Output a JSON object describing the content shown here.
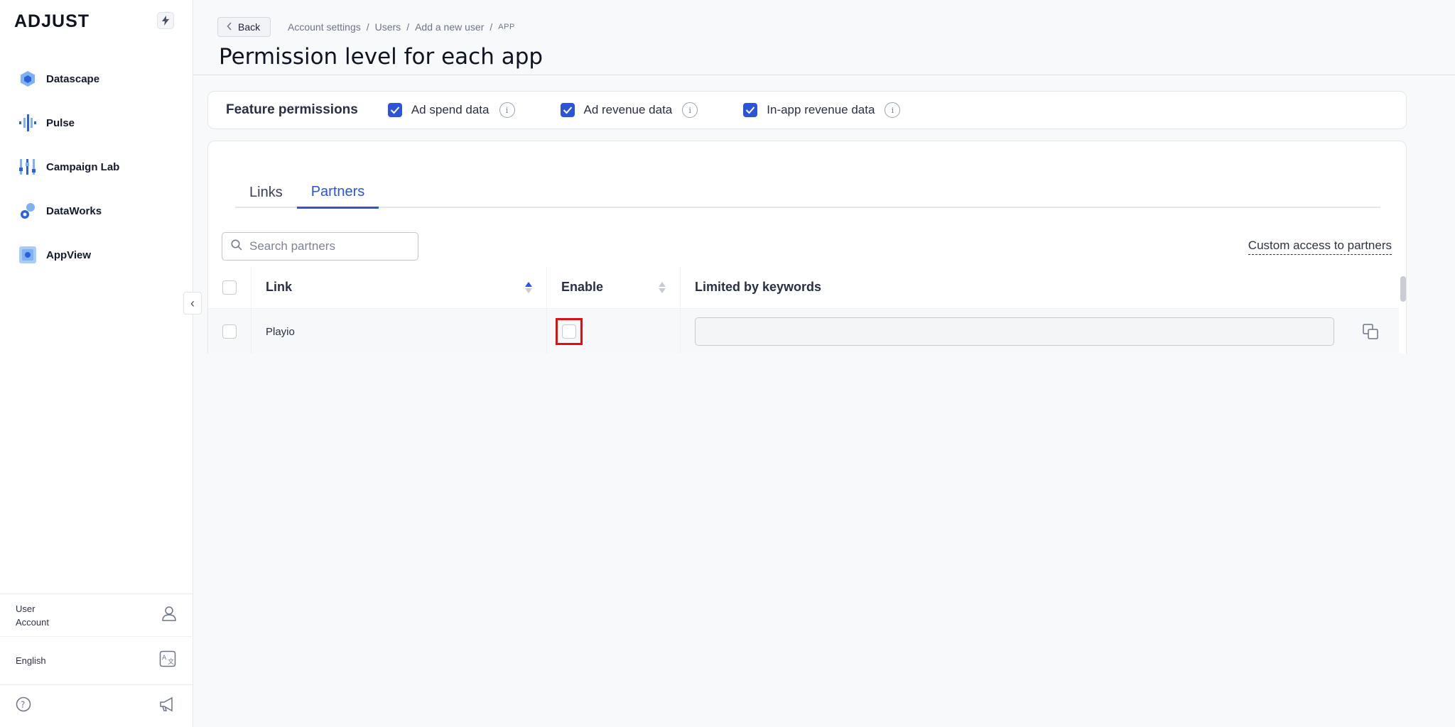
{
  "sidebar": {
    "logo": "ADJUST",
    "items": [
      {
        "label": "Datascape"
      },
      {
        "label": "Pulse"
      },
      {
        "label": "Campaign Lab"
      },
      {
        "label": "DataWorks"
      },
      {
        "label": "AppView"
      }
    ],
    "user_line1": "User",
    "user_line2": "Account",
    "language": "English"
  },
  "header": {
    "back_label": "Back",
    "breadcrumbs": [
      "Account settings",
      "Users",
      "Add a new user",
      "APP"
    ],
    "title": "Permission level for each app"
  },
  "features": {
    "title": "Feature permissions",
    "items": [
      {
        "label": "Ad spend data",
        "checked": true
      },
      {
        "label": "Ad revenue data",
        "checked": true
      },
      {
        "label": "In-app revenue data",
        "checked": true
      }
    ],
    "info_glyph": "i"
  },
  "tabs": [
    {
      "label": "Links",
      "active": false
    },
    {
      "label": "Partners",
      "active": true
    }
  ],
  "search": {
    "placeholder": "Search partners"
  },
  "custom_access_label": "Custom access to partners",
  "table": {
    "columns": [
      "Link",
      "Enable",
      "Limited by keywords"
    ],
    "rows": [
      {
        "link": "Playio",
        "enabled": false,
        "keywords": ""
      }
    ]
  },
  "colors": {
    "accent": "#2b55d6",
    "highlight": "#e01010"
  }
}
